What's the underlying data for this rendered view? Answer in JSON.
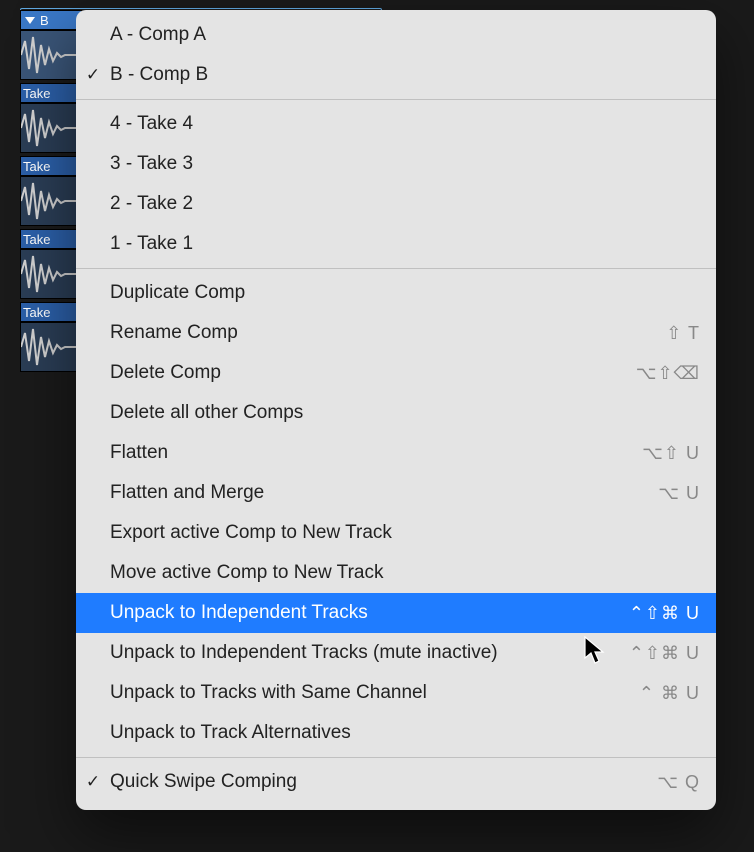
{
  "tracks": [
    {
      "label": "B",
      "first": true
    },
    {
      "label": "Take"
    },
    {
      "label": "Take"
    },
    {
      "label": "Take"
    },
    {
      "label": "Take"
    }
  ],
  "menu": {
    "sections": [
      [
        {
          "checked": false,
          "label": "A - Comp A",
          "shortcut": ""
        },
        {
          "checked": true,
          "label": "B - Comp B",
          "shortcut": ""
        }
      ],
      [
        {
          "checked": false,
          "label": "4 - Take 4",
          "shortcut": ""
        },
        {
          "checked": false,
          "label": "3 - Take 3",
          "shortcut": ""
        },
        {
          "checked": false,
          "label": "2 - Take 2",
          "shortcut": ""
        },
        {
          "checked": false,
          "label": "1 - Take 1",
          "shortcut": ""
        }
      ],
      [
        {
          "checked": false,
          "label": "Duplicate Comp",
          "shortcut": ""
        },
        {
          "checked": false,
          "label": "Rename Comp",
          "shortcut": "⇧ T"
        },
        {
          "checked": false,
          "label": "Delete Comp",
          "shortcut": "⌥⇧⌫"
        },
        {
          "checked": false,
          "label": "Delete all other Comps",
          "shortcut": ""
        },
        {
          "checked": false,
          "label": "Flatten",
          "shortcut": "⌥⇧ U"
        },
        {
          "checked": false,
          "label": "Flatten and Merge",
          "shortcut": "⌥ U"
        },
        {
          "checked": false,
          "label": "Export active Comp to New Track",
          "shortcut": ""
        },
        {
          "checked": false,
          "label": "Move active Comp to New Track",
          "shortcut": ""
        },
        {
          "checked": false,
          "label": "Unpack to Independent Tracks",
          "shortcut": "⌃⇧⌘ U",
          "highlight": true
        },
        {
          "checked": false,
          "label": "Unpack to Independent Tracks (mute inactive)",
          "shortcut": "⌃⇧⌘ U"
        },
        {
          "checked": false,
          "label": "Unpack to Tracks with Same Channel",
          "shortcut": "⌃ ⌘ U"
        },
        {
          "checked": false,
          "label": "Unpack to Track Alternatives",
          "shortcut": ""
        }
      ],
      [
        {
          "checked": true,
          "label": "Quick Swipe Comping",
          "shortcut": "⌥ Q"
        }
      ]
    ]
  },
  "glyphs": {
    "check": "✓"
  }
}
